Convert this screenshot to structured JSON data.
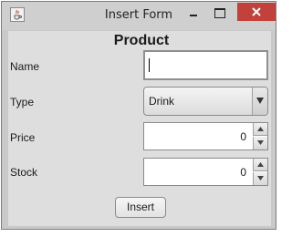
{
  "window": {
    "title": "Insert Form"
  },
  "form": {
    "heading": "Product",
    "name_label": "Name",
    "name_value": "",
    "type_label": "Type",
    "type_selected": "Drink",
    "price_label": "Price",
    "price_value": "0",
    "stock_label": "Stock",
    "stock_value": "0",
    "insert_label": "Insert"
  },
  "icons": {
    "app": "java-cup-icon",
    "minimize": "minimize-icon",
    "maximize": "maximize-icon",
    "close": "close-icon",
    "dropdown": "chevron-down-icon",
    "spin_up": "triangle-up-icon",
    "spin_down": "triangle-down-icon"
  },
  "colors": {
    "close_button": "#c2413a",
    "window_frame": "#c9c9c9",
    "content_background": "#dedede"
  }
}
